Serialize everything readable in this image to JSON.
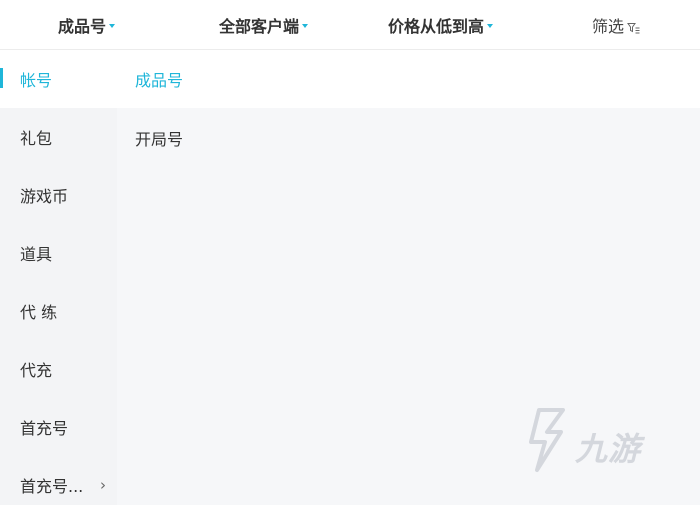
{
  "top_filters": {
    "tabs": [
      {
        "label": "成品号"
      },
      {
        "label": "全部客户端"
      },
      {
        "label": "价格从低到高"
      }
    ],
    "filter_label": "筛选"
  },
  "sidebar": {
    "items": [
      {
        "label": "帐号"
      },
      {
        "label": "礼包"
      },
      {
        "label": "游戏币"
      },
      {
        "label": "道具"
      },
      {
        "label": "代 练"
      },
      {
        "label": "代充"
      },
      {
        "label": "首充号"
      },
      {
        "label": "首充号..."
      }
    ]
  },
  "content": {
    "header_label": "成品号",
    "options": [
      {
        "label": "开局号"
      }
    ]
  },
  "watermark": {
    "text": "九游"
  },
  "colors": {
    "accent": "#1fb6d9",
    "sidebar_bg": "#f3f4f6",
    "content_bg": "#f6f7f9",
    "text": "#333333"
  }
}
